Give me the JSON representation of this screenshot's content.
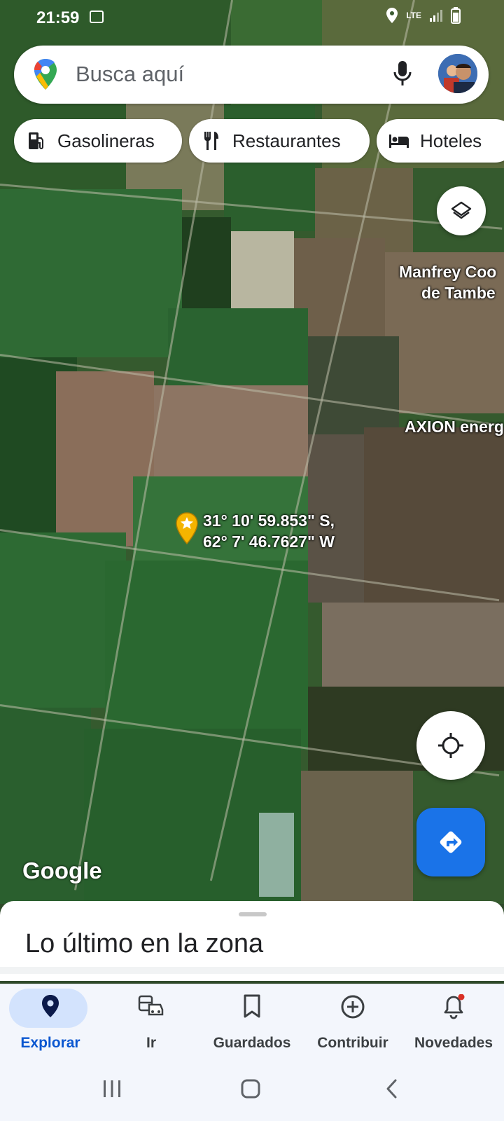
{
  "status_bar": {
    "time": "21:59",
    "network": "LTE"
  },
  "search": {
    "placeholder": "Busca aquí"
  },
  "chips": [
    {
      "label": "Gasolineras",
      "icon": "gas-station-icon"
    },
    {
      "label": "Restaurantes",
      "icon": "restaurant-icon"
    },
    {
      "label": "Hoteles",
      "icon": "hotel-icon"
    }
  ],
  "map": {
    "place_labels": [
      "Manfrey Coo",
      "de Tambe",
      "AXION energ"
    ],
    "pin_coordinates_line1": "31° 10' 59.853\" S,",
    "pin_coordinates_line2": "62° 7' 46.7627\" W",
    "attribution": "Google"
  },
  "sheet": {
    "title": "Lo último en la zona"
  },
  "bottom_nav": [
    {
      "label": "Explorar",
      "icon": "explore-pin-icon",
      "active": true
    },
    {
      "label": "Ir",
      "icon": "commute-icon",
      "active": false
    },
    {
      "label": "Guardados",
      "icon": "bookmark-icon",
      "active": false
    },
    {
      "label": "Contribuir",
      "icon": "add-circle-icon",
      "active": false
    },
    {
      "label": "Novedades",
      "icon": "bell-icon",
      "active": false,
      "badge": true
    }
  ],
  "colors": {
    "accent": "#1a73e8",
    "active_pill": "#d3e3fd",
    "nav_active_text": "#0b57d0",
    "pin": "#f4b400"
  }
}
